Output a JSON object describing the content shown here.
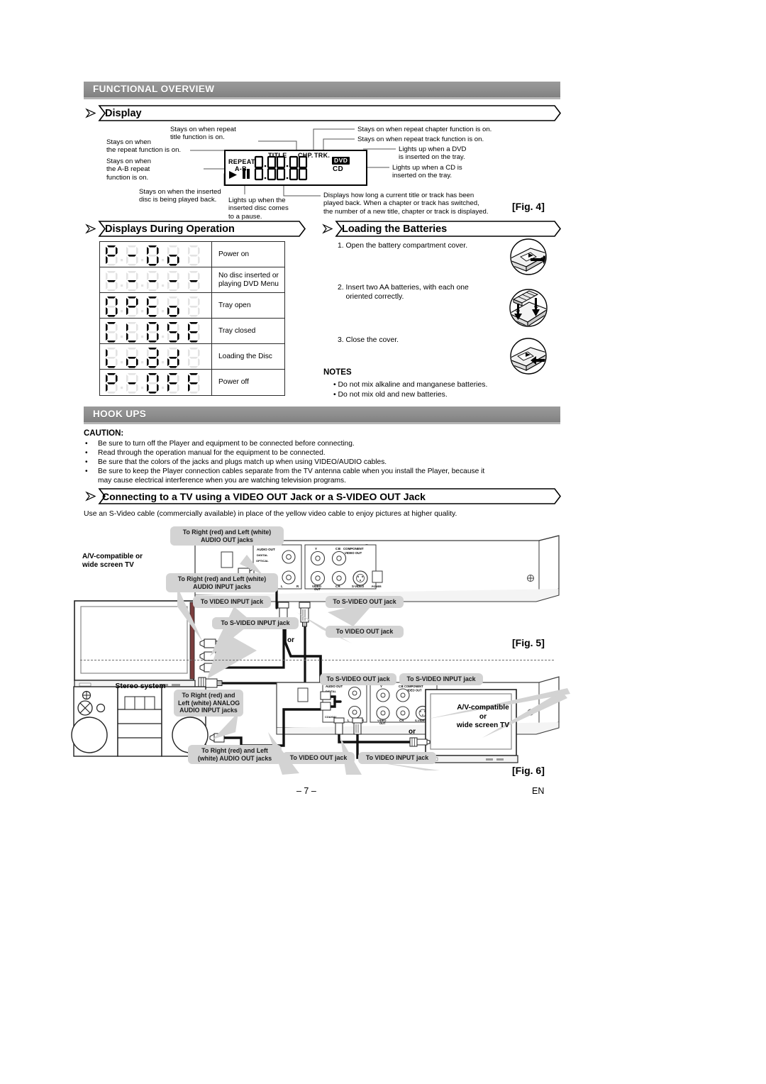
{
  "page": {
    "number": "– 7 –",
    "lang": "EN"
  },
  "sections": [
    {
      "id": "functional-overview",
      "title": "FUNCTIONAL OVERVIEW"
    },
    {
      "id": "hook-ups",
      "title": "HOOK UPS"
    }
  ],
  "subheaders": {
    "display": "Display",
    "displays_during_operation": "Displays During Operation",
    "loading_the_batteries": "Loading the Batteries",
    "connecting_tv": "Connecting to a TV using a VIDEO OUT Jack or a S-VIDEO OUT Jack"
  },
  "display_diagram": {
    "panel_labels": {
      "repeat": "REPEAT",
      "ab": "A-B",
      "title": "TITLE",
      "chp": "CHP.",
      "trk": "TRK.",
      "dvd": "DVD",
      "cd": "CD",
      "digits_row1": "0·00·00",
      "digits_row2": "0·00·00"
    },
    "callouts": {
      "repeat_title": "Stays on when repeat\ntitle function is on.",
      "repeat_func": "Stays on when\nthe repeat function is on.",
      "ab_repeat": "Stays on when\nthe A-B repeat\nfunction is on.",
      "repeat_chapter": "Stays on when repeat chapter function is on.",
      "repeat_track": "Stays on when repeat track function is on.",
      "dvd_inserted": "Lights up when a DVD\nis inserted on the tray.",
      "cd_inserted": "Lights up when a CD is\ninserted on the tray.",
      "playing_back": "Stays on when the inserted\ndisc is being played back.",
      "pause": "Lights up when the\ninserted disc comes\nto a pause.",
      "time_display": "Displays how long a current title or track has been\nplayed back. When a chapter or track has switched,\nthe number of a new title, chapter or track is displayed."
    },
    "fig": "[Fig. 4]"
  },
  "displays_table": {
    "rows": [
      {
        "segments": "P-On",
        "label": "Power on"
      },
      {
        "segments": "----",
        "label": "No disc inserted or\nplaying DVD Menu"
      },
      {
        "segments": "OPEn",
        "label": "Tray open"
      },
      {
        "segments": "CLOSE",
        "label": "Tray closed"
      },
      {
        "segments": "Load",
        "label": "Loading the Disc"
      },
      {
        "segments": "P-OFF",
        "label": "Power off"
      }
    ]
  },
  "batteries": {
    "steps": [
      "1. Open the battery compartment cover.",
      "2. Insert two AA batteries, with each one\n    oriented correctly.",
      "3. Close the cover."
    ],
    "notes_title": "NOTES",
    "notes": [
      "• Do not mix alkaline and manganese batteries.",
      "• Do not mix old and new batteries."
    ]
  },
  "caution": {
    "title": "CAUTION:",
    "items": [
      "Be sure to turn off the Player and equipment to be connected before connecting.",
      "Read through the operation manual for the equipment to be connected.",
      "Be sure that the colors of the jacks and plugs match up when using VIDEO/AUDIO cables.",
      "Be sure to keep the Player connection cables separate from the TV antenna cable when you install the Player, because it\nmay cause electrical interference when you are watching television programs."
    ],
    "bullet": "•"
  },
  "connecting": {
    "intro": "Use an S-Video cable (commercially available) in place of the yellow video cable to enjoy pictures at higher quality."
  },
  "fig5": {
    "label": "[Fig. 5]",
    "device_label": "A/V-compatible or\nwide screen TV",
    "or": "or",
    "callouts": {
      "audio_out": "To Right (red) and Left (white)\nAUDIO OUT jacks",
      "audio_input": "To Right (red) and Left (white)\nAUDIO INPUT jacks",
      "video_input": "To VIDEO INPUT jack",
      "svideo_input": "To S-VIDEO INPUT jack",
      "svideo_out": "To S-VIDEO OUT jack",
      "video_out": "To VIDEO OUT jack"
    },
    "rear_panel": {
      "audio_out": "AUDIO OUT",
      "digital": "DIGITAL",
      "optical": "OPTICAL",
      "coaxial": "COAXIAL",
      "component": "COMPONENT\nVIDEO OUT",
      "video_out": "VIDEO\nOUT",
      "svideo": "S-VIDEO",
      "power": "POWER"
    }
  },
  "fig6": {
    "label": "[Fig. 6]",
    "stereo_label": "Stereo system",
    "tv_label": "A/V-compatible\nor\nwide screen TV",
    "or": "or",
    "callouts": {
      "analog_audio_input": "To Right (red) and\nLeft (white) ANALOG\nAUDIO INPUT jacks",
      "audio_out": "To Right (red) and Left\n(white) AUDIO OUT jacks",
      "svideo_out": "To S-VIDEO OUT jack",
      "svideo_input": "To S-VIDEO INPUT jack",
      "video_out": "To VIDEO OUT jack",
      "video_input": "To VIDEO INPUT jack"
    }
  }
}
